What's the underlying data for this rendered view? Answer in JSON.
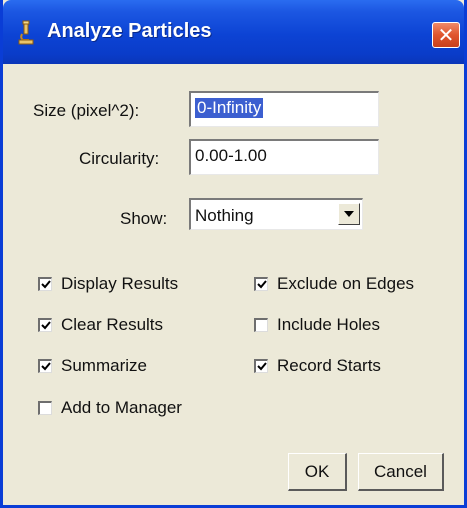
{
  "window": {
    "title": "Analyze Particles"
  },
  "titlebar": {
    "app_icon": "microscope-icon",
    "close_icon": "close-icon",
    "close_glyph": "✕"
  },
  "fields": {
    "size": {
      "label": "Size (pixel^2):",
      "value": "0-Infinity"
    },
    "circularity": {
      "label": "Circularity:",
      "value": "0.00-1.00"
    },
    "show": {
      "label": "Show:",
      "value": "Nothing"
    }
  },
  "checkboxes": {
    "display_results": {
      "label": "Display Results",
      "checked": true
    },
    "clear_results": {
      "label": "Clear Results",
      "checked": true
    },
    "summarize": {
      "label": "Summarize",
      "checked": true
    },
    "add_to_manager": {
      "label": "Add to Manager",
      "checked": false
    },
    "exclude_on_edges": {
      "label": "Exclude on Edges",
      "checked": true
    },
    "include_holes": {
      "label": "Include Holes",
      "checked": false
    },
    "record_starts": {
      "label": "Record Starts",
      "checked": true
    }
  },
  "buttons": {
    "ok": "OK",
    "cancel": "Cancel"
  },
  "colors": {
    "titlebar": "#0c43d4",
    "close": "#e0552e",
    "window_bg": "#ece9d8",
    "selection": "#3c5fd0"
  }
}
